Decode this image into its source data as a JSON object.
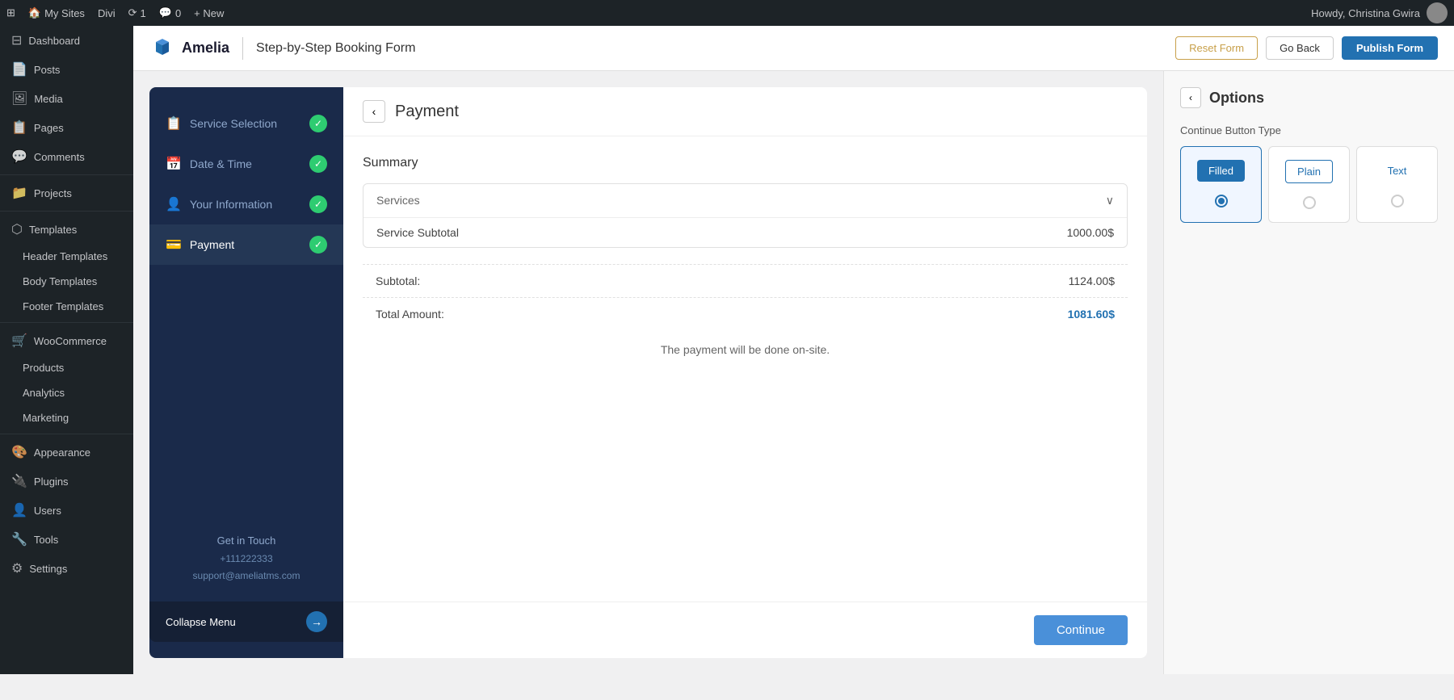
{
  "admin_bar": {
    "wp_icon": "⊞",
    "my_sites": "My Sites",
    "divi": "Divi",
    "updates": "1",
    "comments": "0",
    "new": "+ New",
    "howdy": "Howdy, Christina Gwira"
  },
  "sidebar": {
    "items": [
      {
        "id": "dashboard",
        "label": "Dashboard",
        "icon": "⊟"
      },
      {
        "id": "posts",
        "label": "Posts",
        "icon": "📄"
      },
      {
        "id": "media",
        "label": "Media",
        "icon": "🖼"
      },
      {
        "id": "pages",
        "label": "Pages",
        "icon": "📋"
      },
      {
        "id": "comments",
        "label": "Comments",
        "icon": "💬"
      },
      {
        "id": "projects",
        "label": "Projects",
        "icon": "📁"
      },
      {
        "id": "templates",
        "label": "Templates",
        "icon": "⬡"
      },
      {
        "id": "header-templates",
        "label": "Header Templates",
        "icon": "⬡"
      },
      {
        "id": "body-templates",
        "label": "Body Templates",
        "icon": "⬡"
      },
      {
        "id": "footer-templates",
        "label": "Footer Templates",
        "icon": "⬡"
      },
      {
        "id": "woocommerce",
        "label": "WooCommerce",
        "icon": "🛒"
      },
      {
        "id": "products",
        "label": "Products",
        "icon": "📦"
      },
      {
        "id": "analytics",
        "label": "Analytics",
        "icon": "📊"
      },
      {
        "id": "marketing",
        "label": "Marketing",
        "icon": "📣"
      },
      {
        "id": "appearance",
        "label": "Appearance",
        "icon": "🎨"
      },
      {
        "id": "plugins",
        "label": "Plugins",
        "icon": "🔌"
      },
      {
        "id": "users",
        "label": "Users",
        "icon": "👤"
      },
      {
        "id": "tools",
        "label": "Tools",
        "icon": "🔧"
      },
      {
        "id": "settings",
        "label": "Settings",
        "icon": "⚙"
      }
    ]
  },
  "header": {
    "logo_text": "Amelia",
    "page_title": "Step-by-Step Booking Form",
    "reset_label": "Reset Form",
    "go_back_label": "Go Back",
    "publish_label": "Publish Form"
  },
  "steps": {
    "items": [
      {
        "id": "service-selection",
        "label": "Service Selection",
        "icon": "📋",
        "checked": true
      },
      {
        "id": "date-time",
        "label": "Date & Time",
        "icon": "📅",
        "checked": true
      },
      {
        "id": "your-information",
        "label": "Your Information",
        "icon": "👤",
        "checked": true
      },
      {
        "id": "payment",
        "label": "Payment",
        "icon": "💳",
        "checked": true,
        "active": true
      }
    ],
    "footer": {
      "get_in_touch": "Get in Touch",
      "phone": "+111222333",
      "email": "support@ameliatms.com"
    },
    "collapse_label": "Collapse Menu"
  },
  "payment": {
    "title": "Payment",
    "summary_title": "Summary",
    "services_label": "Services",
    "service_subtotal_label": "Service Subtotal",
    "service_subtotal_value": "1000.00$",
    "subtotal_label": "Subtotal:",
    "subtotal_value": "1124.00$",
    "total_label": "Total Amount:",
    "total_value": "1081.60$",
    "payment_note": "The payment will be done on-site.",
    "continue_label": "Continue"
  },
  "options": {
    "back_icon": "‹",
    "title": "Options",
    "section_title": "Continue Button Type",
    "button_types": [
      {
        "id": "filled",
        "label": "Filled",
        "selected": true
      },
      {
        "id": "plain",
        "label": "Plain",
        "selected": false
      },
      {
        "id": "text",
        "label": "Text",
        "selected": false
      }
    ]
  }
}
